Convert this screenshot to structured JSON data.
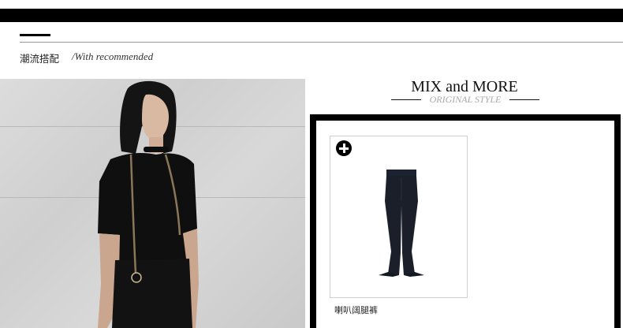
{
  "header": {
    "title_cn": "潮流搭配",
    "title_en": "/With recommended"
  },
  "mix": {
    "title": "MIX and MORE",
    "subtitle": "ORIGINAL STYLE"
  },
  "product": {
    "name": "喇叭阔腿裤",
    "add_icon": "plus-circle-icon"
  },
  "colors": {
    "bar": "#000000",
    "frame": "#000000",
    "subtitle": "#aaaaaa",
    "garment": "#1a1f2a"
  }
}
